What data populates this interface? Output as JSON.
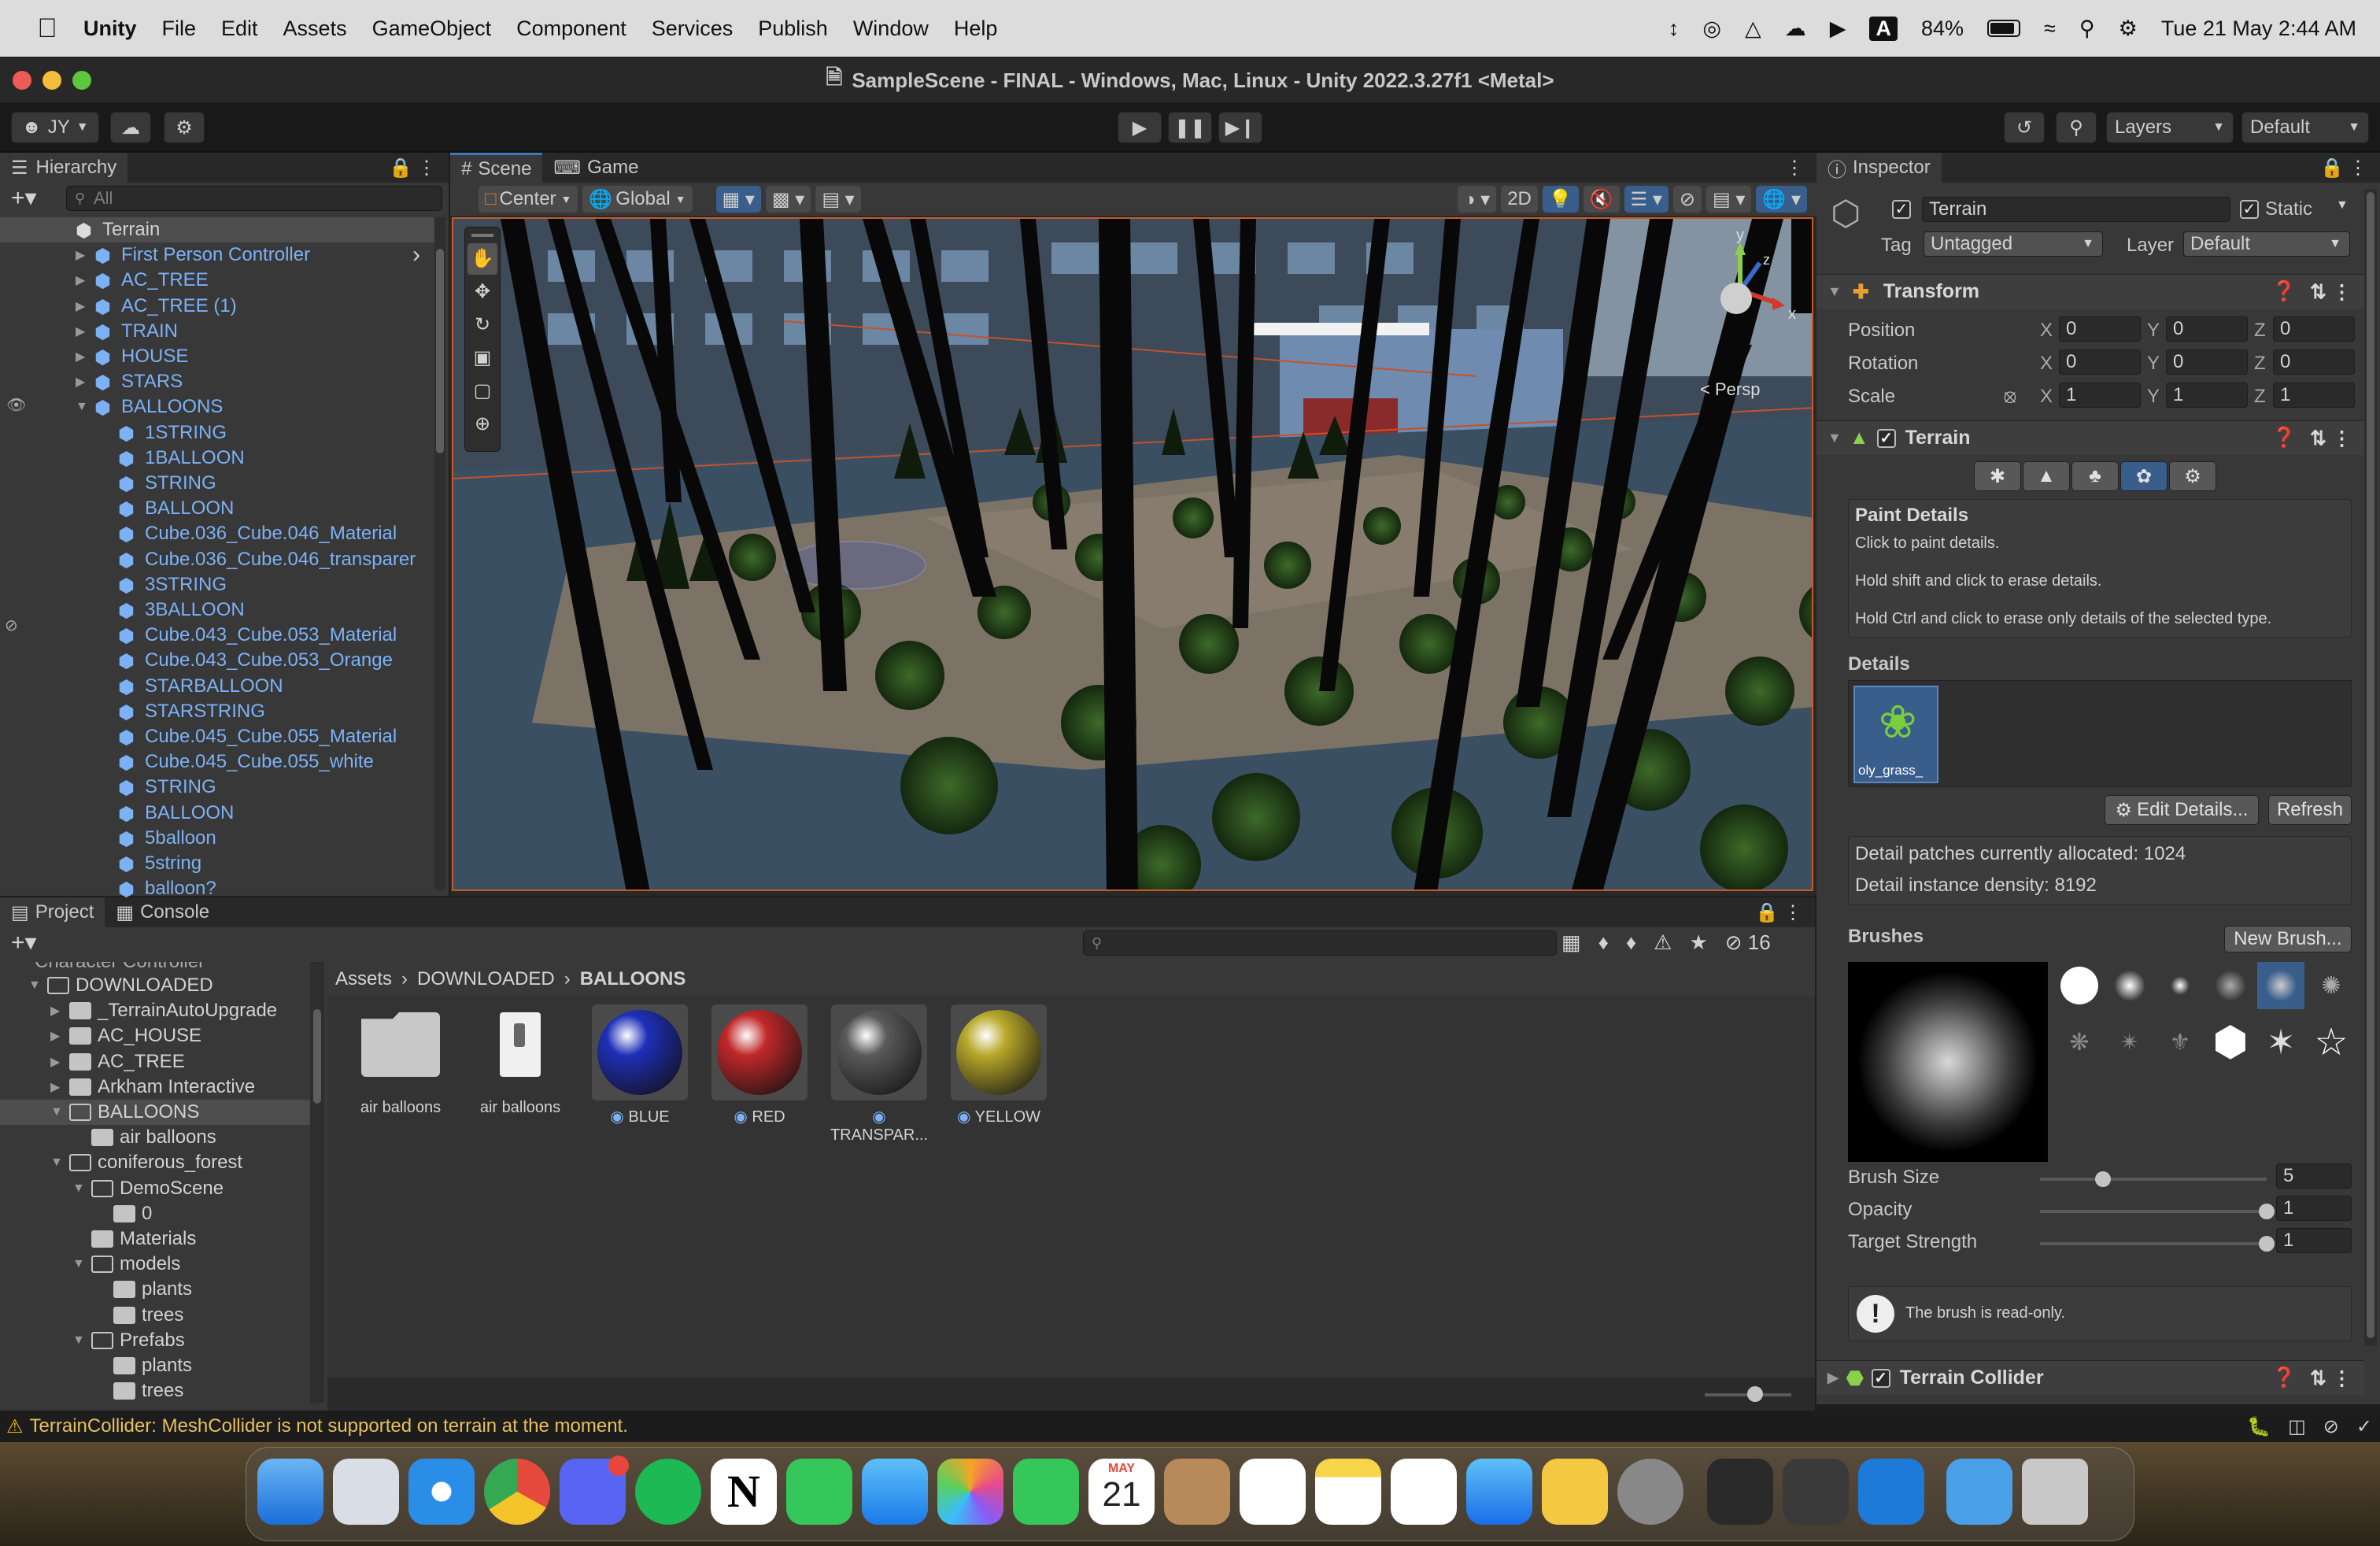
{
  "menubar": {
    "app": "Unity",
    "items": [
      "File",
      "Edit",
      "Assets",
      "GameObject",
      "Component",
      "Services",
      "Publish",
      "Window",
      "Help"
    ],
    "battery": "84%",
    "datetime": "Tue 21 May  2:44 AM",
    "input_source": "A"
  },
  "window": {
    "title": "SampleScene - FINAL - Windows, Mac, Linux - Unity 2022.3.27f1 <Metal>"
  },
  "toolbar": {
    "account": "JY",
    "layers": "Layers",
    "layout": "Default"
  },
  "hierarchy": {
    "tab": "Hierarchy",
    "search_placeholder": "All",
    "items": [
      {
        "label": "Terrain",
        "depth": 0
      },
      {
        "label": "First Person Controller",
        "depth": 0
      },
      {
        "label": "AC_TREE",
        "depth": 0
      },
      {
        "label": "AC_TREE (1)",
        "depth": 0
      },
      {
        "label": "TRAIN",
        "depth": 0
      },
      {
        "label": "HOUSE",
        "depth": 0
      },
      {
        "label": "STARS",
        "depth": 0
      },
      {
        "label": "BALLOONS",
        "depth": 0
      },
      {
        "label": "1STRING",
        "depth": 1
      },
      {
        "label": "1BALLOON",
        "depth": 1
      },
      {
        "label": "STRING",
        "depth": 1
      },
      {
        "label": "BALLOON",
        "depth": 1
      },
      {
        "label": "Cube.036_Cube.046_Material",
        "depth": 1
      },
      {
        "label": "Cube.036_Cube.046_transparer",
        "depth": 1
      },
      {
        "label": "3STRING",
        "depth": 1
      },
      {
        "label": "3BALLOON",
        "depth": 1
      },
      {
        "label": "Cube.043_Cube.053_Material",
        "depth": 1
      },
      {
        "label": "Cube.043_Cube.053_Orange",
        "depth": 1
      },
      {
        "label": "STARBALLOON",
        "depth": 1
      },
      {
        "label": "STARSTRING",
        "depth": 1
      },
      {
        "label": "Cube.045_Cube.055_Material",
        "depth": 1
      },
      {
        "label": "Cube.045_Cube.055_white",
        "depth": 1
      },
      {
        "label": "STRING",
        "depth": 1
      },
      {
        "label": "BALLOON",
        "depth": 1
      },
      {
        "label": "5balloon",
        "depth": 1
      },
      {
        "label": "5string",
        "depth": 1
      },
      {
        "label": "balloon?",
        "depth": 1
      }
    ]
  },
  "scene": {
    "tabs": [
      "Scene",
      "Game"
    ],
    "pivot": "Center",
    "space": "Global",
    "mode_2d": "2D",
    "gizmo_label": "Persp",
    "axis_x": "x",
    "axis_y": "y",
    "axis_z": "z"
  },
  "inspector": {
    "tab": "Inspector",
    "object_name": "Terrain",
    "static_label": "Static",
    "tag_label": "Tag",
    "tag_value": "Untagged",
    "layer_label": "Layer",
    "layer_value": "Default",
    "transform": {
      "title": "Transform",
      "rows": [
        {
          "label": "Position",
          "x": "0",
          "y": "0",
          "z": "0"
        },
        {
          "label": "Rotation",
          "x": "0",
          "y": "0",
          "z": "0"
        },
        {
          "label": "Scale",
          "x": "1",
          "y": "1",
          "z": "1"
        }
      ]
    },
    "terrain": {
      "title": "Terrain",
      "paint_title": "Paint Details",
      "paint_lines": [
        "Click to paint details.",
        "Hold shift and click to erase details.",
        "Hold Ctrl and click to erase only details of the selected type."
      ],
      "details_label": "Details",
      "detail_item": "oly_grass_",
      "edit_details": "Edit Details...",
      "refresh": "Refresh",
      "allocated": "Detail patches currently allocated: 1024",
      "density": "Detail instance density: 8192",
      "brushes_label": "Brushes",
      "new_brush": "New Brush...",
      "brush_size_label": "Brush Size",
      "brush_size": "5",
      "brush_size_fraction": 0.25,
      "opacity_label": "Opacity",
      "opacity": "1",
      "opacity_fraction": 1.0,
      "target_strength_label": "Target Strength",
      "target_strength": "1",
      "target_strength_fraction": 1.0,
      "readonly_note": "The brush is read-only."
    },
    "collider_title": "Terrain Collider"
  },
  "project": {
    "tabs": [
      "Project",
      "Console"
    ],
    "hidden_count": "16",
    "breadcrumb": [
      "Assets",
      "DOWNLOADED",
      "BALLOONS"
    ],
    "tree": [
      {
        "label": "DOWNLOADED",
        "depth": 0,
        "open": true
      },
      {
        "label": "_TerrainAutoUpgrade",
        "depth": 1,
        "open": false
      },
      {
        "label": "AC_HOUSE",
        "depth": 1,
        "open": false
      },
      {
        "label": "AC_TREE",
        "depth": 1,
        "open": false
      },
      {
        "label": "Arkham Interactive",
        "depth": 1,
        "open": false
      },
      {
        "label": "BALLOONS",
        "depth": 1,
        "open": true
      },
      {
        "label": "air balloons",
        "depth": 2,
        "open": false
      },
      {
        "label": "coniferous_forest",
        "depth": 1,
        "open": true
      },
      {
        "label": "DemoScene",
        "depth": 2,
        "open": true
      },
      {
        "label": "0",
        "depth": 3,
        "open": false
      },
      {
        "label": "Materials",
        "depth": 2,
        "open": false
      },
      {
        "label": "models",
        "depth": 2,
        "open": true
      },
      {
        "label": "plants",
        "depth": 3,
        "open": false
      },
      {
        "label": "trees",
        "depth": 3,
        "open": false
      },
      {
        "label": "Prefabs",
        "depth": 2,
        "open": true
      },
      {
        "label": "plants",
        "depth": 3,
        "open": false
      },
      {
        "label": "trees",
        "depth": 3,
        "open": false
      }
    ],
    "assets": [
      {
        "label": "air balloons",
        "kind": "folder"
      },
      {
        "label": "air balloons",
        "kind": "file"
      },
      {
        "label": "BLUE",
        "kind": "material",
        "color": "#1f2fb8"
      },
      {
        "label": "RED",
        "kind": "material",
        "color": "#c0282a"
      },
      {
        "label": "TRANSPAR...",
        "kind": "material",
        "color": "#5a5a5a"
      },
      {
        "label": "YELLOW",
        "kind": "material",
        "color": "#b8a82a"
      }
    ]
  },
  "statusbar": {
    "message": "TerrainCollider: MeshCollider is not supported on terrain at the moment."
  },
  "dock": {
    "calendar_month": "MAY",
    "calendar_day": "21"
  }
}
